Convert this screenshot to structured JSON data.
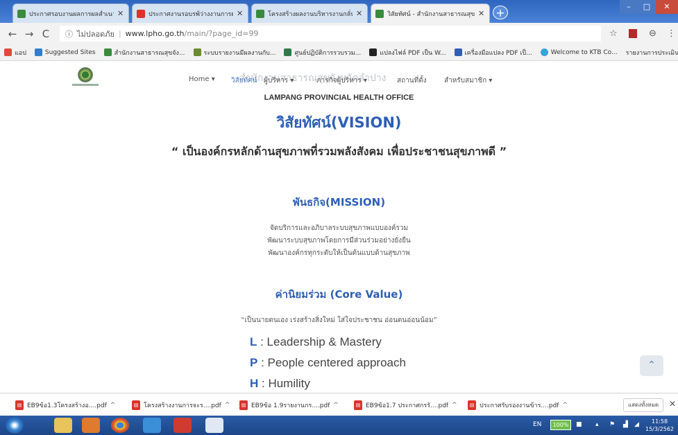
{
  "browser": {
    "tabs": [
      {
        "title": "ประกาศรอบงานผลการผลสำเนาการนี",
        "favicon_color": "#3a8a3e",
        "active": false
      },
      {
        "title": "ประกาศงานรอบรพ้ว่างงานการผลงาน",
        "favicon_color": "#d9342b",
        "active": false
      },
      {
        "title": "โครงสร้างผลงานบริหารงานกลั่นการ",
        "favicon_color": "#3a8a3e",
        "active": false
      },
      {
        "title": "วิสัยทัศน์ - สำนักงานสาธารณสุขจังหวัด",
        "favicon_color": "#3a8a3e",
        "active": true
      }
    ],
    "new_tab": "+",
    "window_controls": {
      "minimize": "–",
      "maximize": "□",
      "close": "✕"
    },
    "nav": {
      "back": "←",
      "forward": "→",
      "reload": "C"
    },
    "address": {
      "security": "ไม่ปลอดภัย",
      "domain": "www.lpho.go.th",
      "path": "/main/?page_id=99"
    },
    "icons": {
      "star": "☆",
      "menu": "⋮"
    },
    "bookmarks": [
      {
        "label": "แอป",
        "color": "#e04c3a"
      },
      {
        "label": "Suggested Sites",
        "color": "#2f7ecb"
      },
      {
        "label": "สำนักงานสาธารณสุขจัง...",
        "color": "#3a8a3e"
      },
      {
        "label": "ระบบรายงานมีผลงานกับ...",
        "color": "#6a8a2e"
      },
      {
        "label": "ศูนย์ปฏิบัติการรวบรวม...",
        "color": "#2e7a4a"
      },
      {
        "label": "แปลงไฟล์ PDF เป็น W...",
        "color": "#222"
      },
      {
        "label": "เครื่องมือแปลง PDF เป็...",
        "color": "#2f5fb3"
      },
      {
        "label": "Welcome to KTB Co...",
        "color": "#38a3d8"
      },
      {
        "label": "รายงานการประเมินผล...",
        "color": "#777"
      }
    ],
    "bookmarks_more": "»"
  },
  "site": {
    "menu": [
      {
        "label": "Home ▾",
        "active": false
      },
      {
        "label": "วิสัยทัศน์",
        "active": true
      },
      {
        "label": "ผู้บริหาร ▾",
        "active": false
      },
      {
        "label": "ภารกิจผู้บริหาร ▾",
        "active": false
      },
      {
        "label": "สถานที่ตั้ง",
        "active": false
      },
      {
        "label": "สำหรับสมาชิก ▾",
        "active": false
      }
    ],
    "ghost_title": "สำนักงานสาธารณสุขจังหวัดลำปาง",
    "department": "LAMPANG PROVINCIAL HEALTH OFFICE",
    "vision_heading": "วิสัยทัศน์(VISION)",
    "vision_text": "“ เป็นองค์กรหลักด้านสุขภาพที่รวมพลังสังคม เพื่อประชาชนสุขภาพดี ”",
    "mission_heading": "พันธกิจ(MISSION)",
    "mission_lines": [
      "จัดบริการและอภิบาลระบบสุขภาพแบบองค์รวม",
      "พัฒนาระบบสุขภาพโดยการมีส่วนร่วมอย่างยั่งยืน",
      "พัฒนาองค์กรทุกระดับให้เป็นต้นแบบด้านสุขภาพ"
    ],
    "core_heading": "ค่านิยมร่วม (Core Value)",
    "core_quote": "“เป็นนายตนเอง เร่งสร้างสิ่งใหม่ ใส่ใจประชาชน อ่อนตนอ่อนน้อม”",
    "core_values": [
      {
        "letter": "L",
        "text": " : Leadership & Mastery"
      },
      {
        "letter": "P",
        "text": " : People centered approach"
      },
      {
        "letter": "H",
        "text": " : Humility"
      }
    ],
    "scroll_top": "⌃"
  },
  "downloads": {
    "items": [
      "EB9ข้อ1.3โครงสร้างอ....pdf",
      "โครงสร้างงานการจะร....pdf",
      "EB9ข้อ 1.9รายงานกร....pdf",
      "EB9ข้อ1.7 ประกาศกรรั....pdf",
      "ประกาศรับรองงานข้าร....pdf"
    ],
    "show_all": "แสดงทั้งหมด",
    "close": "✕"
  },
  "taskbar": {
    "lang": "EN",
    "battery": "100%",
    "time": "11:58",
    "date": "15/3/2562"
  }
}
